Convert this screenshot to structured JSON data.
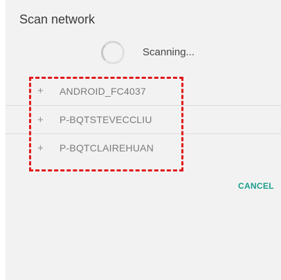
{
  "dialog": {
    "title": "Scan network",
    "scan_status": "Scanning...",
    "devices": [
      {
        "icon": "+",
        "name": "ANDROID_FC4037"
      },
      {
        "icon": "+",
        "name": "P-BQTSTEVECCLIU"
      },
      {
        "icon": "+",
        "name": "P-BQTCLAIREHUAN"
      }
    ],
    "cancel_label": "CANCEL"
  },
  "colors": {
    "accent": "#1a9e8c",
    "highlight": "#e0191c",
    "dialog_bg": "#f2f2f2"
  },
  "icons": {
    "spinner": "loading-spinner-icon",
    "add": "plus-icon"
  }
}
